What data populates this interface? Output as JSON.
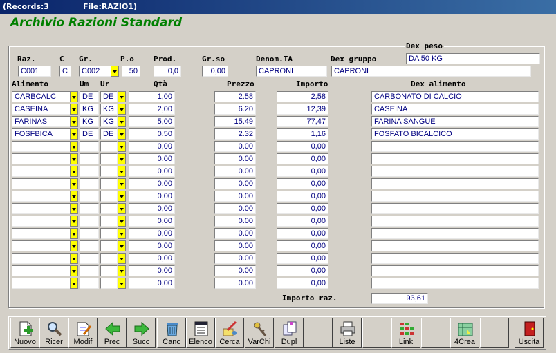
{
  "window": {
    "records": "(Records:3",
    "file": "File:RAZIO1)"
  },
  "app_title": "Archivio Razioni Standard",
  "legend": "Dex peso",
  "header": {
    "labels": {
      "raz": "Raz.",
      "c": "C",
      "gr": "Gr.",
      "po": "P.o",
      "prod": "Prod.",
      "grso": "Gr.so",
      "denom": "Denom.TA",
      "dexgruppo": "Dex gruppo"
    },
    "values": {
      "raz": "C001",
      "c": "C",
      "gr": "C002",
      "po": "50",
      "prod": "0,0",
      "grso": "0,00",
      "denom": "CAPRONI",
      "dexgruppo": "CAPRONI",
      "dexpeso": "DA 50 KG"
    }
  },
  "columns": {
    "alimento": "Alimento",
    "um": "Um",
    "ur": "Ur",
    "qta": "Qtà",
    "prezzo": "Prezzo",
    "importo": "Importo",
    "dex": "Dex alimento"
  },
  "rows": [
    {
      "alimento": "CARBCALC",
      "um": "DE",
      "ur": "DE",
      "qta": "1,00",
      "prezzo": "2.58",
      "importo": "2,58",
      "dex": "CARBONATO DI CALCIO"
    },
    {
      "alimento": "CASEINA",
      "um": "KG",
      "ur": "KG",
      "qta": "2,00",
      "prezzo": "6.20",
      "importo": "12,39",
      "dex": "CASEINA"
    },
    {
      "alimento": "FARINAS",
      "um": "KG",
      "ur": "KG",
      "qta": "5,00",
      "prezzo": "15.49",
      "importo": "77,47",
      "dex": "FARINA SANGUE"
    },
    {
      "alimento": "FOSFBICA",
      "um": "DE",
      "ur": "DE",
      "qta": "0,50",
      "prezzo": "2.32",
      "importo": "1,16",
      "dex": "FOSFATO BICALCICO"
    },
    {
      "alimento": "",
      "um": "",
      "ur": "",
      "qta": "0,00",
      "prezzo": "0.00",
      "importo": "0,00",
      "dex": ""
    },
    {
      "alimento": "",
      "um": "",
      "ur": "",
      "qta": "0,00",
      "prezzo": "0.00",
      "importo": "0,00",
      "dex": ""
    },
    {
      "alimento": "",
      "um": "",
      "ur": "",
      "qta": "0,00",
      "prezzo": "0.00",
      "importo": "0,00",
      "dex": ""
    },
    {
      "alimento": "",
      "um": "",
      "ur": "",
      "qta": "0,00",
      "prezzo": "0.00",
      "importo": "0,00",
      "dex": ""
    },
    {
      "alimento": "",
      "um": "",
      "ur": "",
      "qta": "0,00",
      "prezzo": "0.00",
      "importo": "0,00",
      "dex": ""
    },
    {
      "alimento": "",
      "um": "",
      "ur": "",
      "qta": "0,00",
      "prezzo": "0.00",
      "importo": "0,00",
      "dex": ""
    },
    {
      "alimento": "",
      "um": "",
      "ur": "",
      "qta": "0,00",
      "prezzo": "0.00",
      "importo": "0,00",
      "dex": ""
    },
    {
      "alimento": "",
      "um": "",
      "ur": "",
      "qta": "0,00",
      "prezzo": "0.00",
      "importo": "0,00",
      "dex": ""
    },
    {
      "alimento": "",
      "um": "",
      "ur": "",
      "qta": "0,00",
      "prezzo": "0.00",
      "importo": "0,00",
      "dex": ""
    },
    {
      "alimento": "",
      "um": "",
      "ur": "",
      "qta": "0,00",
      "prezzo": "0.00",
      "importo": "0,00",
      "dex": ""
    },
    {
      "alimento": "",
      "um": "",
      "ur": "",
      "qta": "0,00",
      "prezzo": "0.00",
      "importo": "0,00",
      "dex": ""
    },
    {
      "alimento": "",
      "um": "",
      "ur": "",
      "qta": "0,00",
      "prezzo": "0.00",
      "importo": "0,00",
      "dex": ""
    }
  ],
  "total": {
    "label": "Importo raz.",
    "value": "93,61"
  },
  "toolbar": [
    {
      "name": "nuovo",
      "label": "Nuovo",
      "icon": "new-document-icon"
    },
    {
      "name": "ricer",
      "label": "Ricer",
      "icon": "magnifier-icon"
    },
    {
      "name": "modif",
      "label": "Modif",
      "icon": "edit-document-icon"
    },
    {
      "name": "prec",
      "label": "Prec",
      "icon": "arrow-left-icon"
    },
    {
      "name": "succ",
      "label": "Succ",
      "icon": "arrow-right-icon"
    },
    {
      "name": "canc",
      "label": "Canc",
      "icon": "trash-icon"
    },
    {
      "name": "elenco",
      "label": "Elenco",
      "icon": "list-icon"
    },
    {
      "name": "cerca",
      "label": "Cerca",
      "icon": "search-broom-icon"
    },
    {
      "name": "varchi",
      "label": "VarChi",
      "icon": "keys-icon"
    },
    {
      "name": "dupl",
      "label": "Dupl",
      "icon": "duplicate-icon"
    },
    {
      "name": "empty1",
      "label": "",
      "icon": ""
    },
    {
      "name": "liste",
      "label": "Liste",
      "icon": "printer-icon"
    },
    {
      "name": "empty2",
      "label": "",
      "icon": ""
    },
    {
      "name": "link",
      "label": "Link",
      "icon": "link-grid-icon"
    },
    {
      "name": "empty3",
      "label": "",
      "icon": ""
    },
    {
      "name": "4crea",
      "label": "4Crea",
      "icon": "create-icon"
    },
    {
      "name": "empty4",
      "label": "",
      "icon": ""
    },
    {
      "name": "uscita",
      "label": "Uscita",
      "icon": "exit-door-icon"
    }
  ],
  "colors": {
    "title_green": "#008000",
    "field_text": "#000080",
    "dropdown": "#ffff00",
    "titlebar": "#0a246a"
  }
}
